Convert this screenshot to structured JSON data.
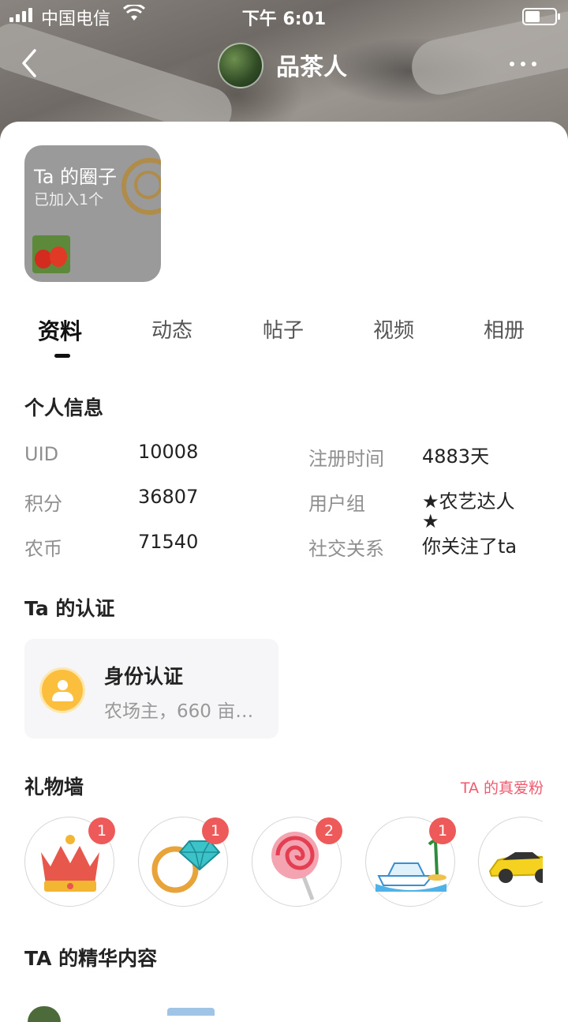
{
  "status": {
    "carrier": "中国电信",
    "time": "下午 6:01"
  },
  "nav": {
    "title": "品茶人"
  },
  "circle": {
    "title": "Ta 的圈子",
    "subtitle": "已加入1个"
  },
  "tabs": [
    {
      "label": "资料",
      "active": true
    },
    {
      "label": "动态",
      "active": false
    },
    {
      "label": "帖子",
      "active": false
    },
    {
      "label": "视频",
      "active": false
    },
    {
      "label": "相册",
      "active": false
    }
  ],
  "personal_info": {
    "title": "个人信息",
    "rows": [
      {
        "label": "UID",
        "value": "10008"
      },
      {
        "label": "积分",
        "value": "36807"
      },
      {
        "label": "农币",
        "value": "71540"
      },
      {
        "label": "注册时间",
        "value": "4883天"
      },
      {
        "label": "用户组",
        "value": "★农艺达人"
      },
      {
        "label": "用户组_cont",
        "value": "★"
      },
      {
        "label": "社交关系",
        "value": "你关注了ta"
      }
    ]
  },
  "certification": {
    "title": "Ta 的认证",
    "card_title": "身份认证",
    "card_desc": "农场主，660 亩…"
  },
  "gifts": {
    "title": "礼物墙",
    "fans_link": "TA 的真爱粉",
    "items": [
      {
        "icon": "crown-icon",
        "count": "1"
      },
      {
        "icon": "diamond-ring-icon",
        "count": "1"
      },
      {
        "icon": "lollipop-icon",
        "count": "2"
      },
      {
        "icon": "yacht-icon",
        "count": "1"
      },
      {
        "icon": "sports-car-icon",
        "count": ""
      }
    ]
  },
  "featured": {
    "title": "TA 的精华内容"
  },
  "colors": {
    "accent_pink": "#f05a6e",
    "badge_red": "#ee5a5a",
    "cert_yellow": "#fbbf3d"
  }
}
